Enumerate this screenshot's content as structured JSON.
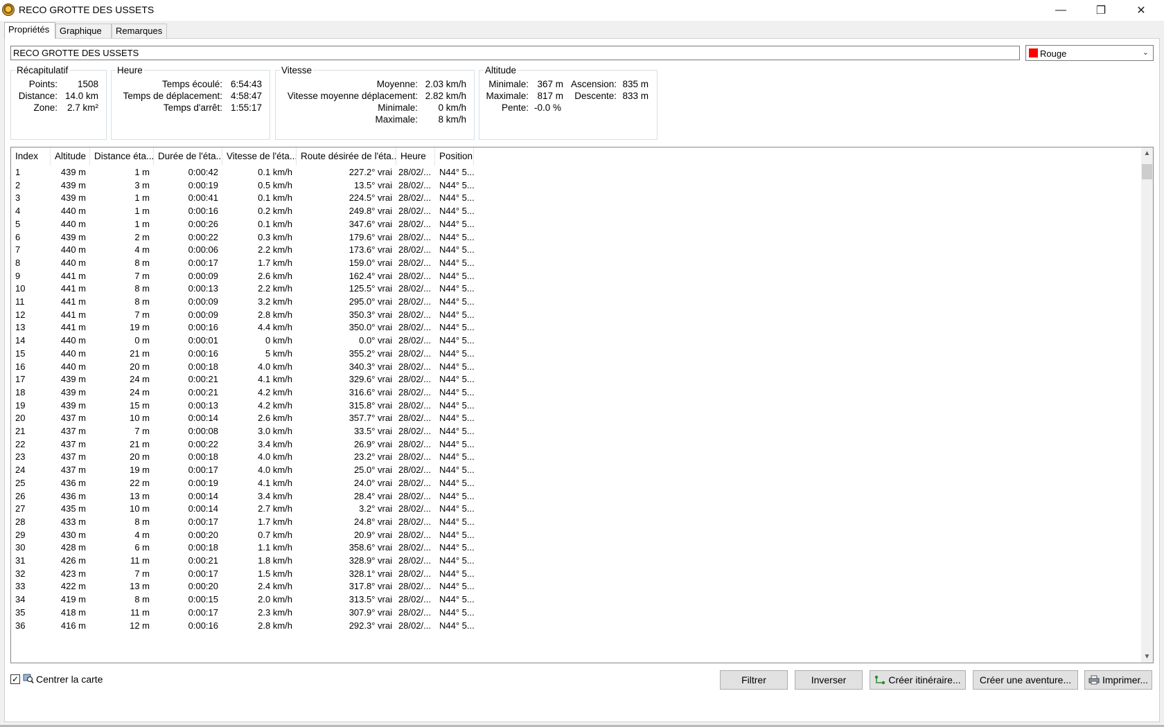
{
  "window": {
    "title": "RECO GROTTE DES USSETS",
    "minimize_glyph": "—",
    "restore_glyph": "❐",
    "close_glyph": "✕"
  },
  "tabs": [
    {
      "label": "Propriétés",
      "active": true
    },
    {
      "label": "Graphique",
      "active": false
    },
    {
      "label": "Remarques",
      "active": false
    }
  ],
  "track_name": "RECO GROTTE DES USSETS",
  "color": {
    "label": "Rouge",
    "swatch": "#ff0000"
  },
  "summary": {
    "legend": "Récapitulatif",
    "points_label": "Points:",
    "points_value": "1508",
    "distance_label": "Distance:",
    "distance_value": "14.0 km",
    "zone_label": "Zone:",
    "zone_value": "2.7 km²"
  },
  "time": {
    "legend": "Heure",
    "elapsed_label": "Temps écoulé:",
    "elapsed_value": "6:54:43",
    "moving_label": "Temps de déplacement:",
    "moving_value": "4:58:47",
    "stopped_label": "Temps d'arrêt:",
    "stopped_value": "1:55:17"
  },
  "speed": {
    "legend": "Vitesse",
    "avg_label": "Moyenne:",
    "avg_value": "2.03 km/h",
    "moving_avg_label": "Vitesse moyenne déplacement:",
    "moving_avg_value": "2.82 km/h",
    "min_label": "Minimale:",
    "min_value": "0 km/h",
    "max_label": "Maximale:",
    "max_value": "8 km/h"
  },
  "altitude": {
    "legend": "Altitude",
    "min_label": "Minimale:",
    "min_value": "367 m",
    "max_label": "Maximale:",
    "max_value": "817 m",
    "slope_label": "Pente:",
    "slope_value": "-0.0 %",
    "ascent_label": "Ascension:",
    "ascent_value": "835 m",
    "descent_label": "Descente:",
    "descent_value": "833 m"
  },
  "table": {
    "columns": [
      "Index",
      "Altitude",
      "Distance éta...",
      "Durée de l'éta...",
      "Vitesse de l'éta...",
      "Route désirée de l'éta...",
      "Heure",
      "Position"
    ],
    "rows": [
      [
        "1",
        "439 m",
        "1 m",
        "0:00:42",
        "0.1 km/h",
        "227.2° vrai",
        "28/02/...",
        "N44° 5..."
      ],
      [
        "2",
        "439 m",
        "3 m",
        "0:00:19",
        "0.5 km/h",
        "13.5° vrai",
        "28/02/...",
        "N44° 5..."
      ],
      [
        "3",
        "439 m",
        "1 m",
        "0:00:41",
        "0.1 km/h",
        "224.5° vrai",
        "28/02/...",
        "N44° 5..."
      ],
      [
        "4",
        "440 m",
        "1 m",
        "0:00:16",
        "0.2 km/h",
        "249.8° vrai",
        "28/02/...",
        "N44° 5..."
      ],
      [
        "5",
        "440 m",
        "1 m",
        "0:00:26",
        "0.1 km/h",
        "347.6° vrai",
        "28/02/...",
        "N44° 5..."
      ],
      [
        "6",
        "439 m",
        "2 m",
        "0:00:22",
        "0.3 km/h",
        "179.6° vrai",
        "28/02/...",
        "N44° 5..."
      ],
      [
        "7",
        "440 m",
        "4 m",
        "0:00:06",
        "2.2 km/h",
        "173.6° vrai",
        "28/02/...",
        "N44° 5..."
      ],
      [
        "8",
        "440 m",
        "8 m",
        "0:00:17",
        "1.7 km/h",
        "159.0° vrai",
        "28/02/...",
        "N44° 5..."
      ],
      [
        "9",
        "441 m",
        "7 m",
        "0:00:09",
        "2.6 km/h",
        "162.4° vrai",
        "28/02/...",
        "N44° 5..."
      ],
      [
        "10",
        "441 m",
        "8 m",
        "0:00:13",
        "2.2 km/h",
        "125.5° vrai",
        "28/02/...",
        "N44° 5..."
      ],
      [
        "11",
        "441 m",
        "8 m",
        "0:00:09",
        "3.2 km/h",
        "295.0° vrai",
        "28/02/...",
        "N44° 5..."
      ],
      [
        "12",
        "441 m",
        "7 m",
        "0:00:09",
        "2.8 km/h",
        "350.3° vrai",
        "28/02/...",
        "N44° 5..."
      ],
      [
        "13",
        "441 m",
        "19 m",
        "0:00:16",
        "4.4 km/h",
        "350.0° vrai",
        "28/02/...",
        "N44° 5..."
      ],
      [
        "14",
        "440 m",
        "0 m",
        "0:00:01",
        "0 km/h",
        "0.0° vrai",
        "28/02/...",
        "N44° 5..."
      ],
      [
        "15",
        "440 m",
        "21 m",
        "0:00:16",
        "5 km/h",
        "355.2° vrai",
        "28/02/...",
        "N44° 5..."
      ],
      [
        "16",
        "440 m",
        "20 m",
        "0:00:18",
        "4.0 km/h",
        "340.3° vrai",
        "28/02/...",
        "N44° 5..."
      ],
      [
        "17",
        "439 m",
        "24 m",
        "0:00:21",
        "4.1 km/h",
        "329.6° vrai",
        "28/02/...",
        "N44° 5..."
      ],
      [
        "18",
        "439 m",
        "24 m",
        "0:00:21",
        "4.2 km/h",
        "316.6° vrai",
        "28/02/...",
        "N44° 5..."
      ],
      [
        "19",
        "439 m",
        "15 m",
        "0:00:13",
        "4.2 km/h",
        "315.8° vrai",
        "28/02/...",
        "N44° 5..."
      ],
      [
        "20",
        "437 m",
        "10 m",
        "0:00:14",
        "2.6 km/h",
        "357.7° vrai",
        "28/02/...",
        "N44° 5..."
      ],
      [
        "21",
        "437 m",
        "7 m",
        "0:00:08",
        "3.0 km/h",
        "33.5° vrai",
        "28/02/...",
        "N44° 5..."
      ],
      [
        "22",
        "437 m",
        "21 m",
        "0:00:22",
        "3.4 km/h",
        "26.9° vrai",
        "28/02/...",
        "N44° 5..."
      ],
      [
        "23",
        "437 m",
        "20 m",
        "0:00:18",
        "4.0 km/h",
        "23.2° vrai",
        "28/02/...",
        "N44° 5..."
      ],
      [
        "24",
        "437 m",
        "19 m",
        "0:00:17",
        "4.0 km/h",
        "25.0° vrai",
        "28/02/...",
        "N44° 5..."
      ],
      [
        "25",
        "436 m",
        "22 m",
        "0:00:19",
        "4.1 km/h",
        "24.0° vrai",
        "28/02/...",
        "N44° 5..."
      ],
      [
        "26",
        "436 m",
        "13 m",
        "0:00:14",
        "3.4 km/h",
        "28.4° vrai",
        "28/02/...",
        "N44° 5..."
      ],
      [
        "27",
        "435 m",
        "10 m",
        "0:00:14",
        "2.7 km/h",
        "3.2° vrai",
        "28/02/...",
        "N44° 5..."
      ],
      [
        "28",
        "433 m",
        "8 m",
        "0:00:17",
        "1.7 km/h",
        "24.8° vrai",
        "28/02/...",
        "N44° 5..."
      ],
      [
        "29",
        "430 m",
        "4 m",
        "0:00:20",
        "0.7 km/h",
        "20.9° vrai",
        "28/02/...",
        "N44° 5..."
      ],
      [
        "30",
        "428 m",
        "6 m",
        "0:00:18",
        "1.1 km/h",
        "358.6° vrai",
        "28/02/...",
        "N44° 5..."
      ],
      [
        "31",
        "426 m",
        "11 m",
        "0:00:21",
        "1.8 km/h",
        "328.9° vrai",
        "28/02/...",
        "N44° 5..."
      ],
      [
        "32",
        "423 m",
        "7 m",
        "0:00:17",
        "1.5 km/h",
        "328.1° vrai",
        "28/02/...",
        "N44° 5..."
      ],
      [
        "33",
        "422 m",
        "13 m",
        "0:00:20",
        "2.4 km/h",
        "317.8° vrai",
        "28/02/...",
        "N44° 5..."
      ],
      [
        "34",
        "419 m",
        "8 m",
        "0:00:15",
        "2.0 km/h",
        "313.5° vrai",
        "28/02/...",
        "N44° 5..."
      ],
      [
        "35",
        "418 m",
        "11 m",
        "0:00:17",
        "2.3 km/h",
        "307.9° vrai",
        "28/02/...",
        "N44° 5..."
      ],
      [
        "36",
        "416 m",
        "12 m",
        "0:00:16",
        "2.8 km/h",
        "292.3° vrai",
        "28/02/...",
        "N44° 5..."
      ]
    ]
  },
  "footer": {
    "center_map_label": "Centrer la carte",
    "center_map_checked": true,
    "buttons": {
      "filter": "Filtrer",
      "reverse": "Inverser",
      "create_route": "Créer itinéraire...",
      "create_adventure": "Créer une aventure...",
      "print": "Imprimer..."
    }
  }
}
